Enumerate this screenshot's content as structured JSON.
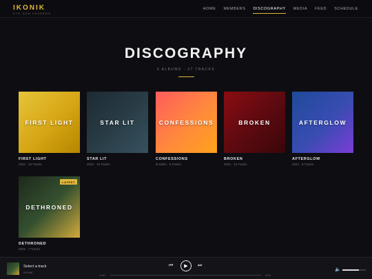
{
  "brand": {
    "logo": "IKONIK",
    "tagline": "5TH GEN LEADERS"
  },
  "nav": [
    {
      "label": "HOME",
      "active": false
    },
    {
      "label": "MEMBERS",
      "active": false
    },
    {
      "label": "DISCOGRAPHY",
      "active": true
    },
    {
      "label": "MEDIA",
      "active": false
    },
    {
      "label": "FEED",
      "active": false
    },
    {
      "label": "SCHEDULE",
      "active": false
    }
  ],
  "hero": {
    "title": "DISCOGRAPHY",
    "subtitle": "6 ALBUMS · 37 TRACKS"
  },
  "albums": [
    {
      "cover_text": "FIRST LIGHT",
      "title": "FIRST LIGHT",
      "meta": "2022 · 10 Tracks",
      "badge": ""
    },
    {
      "cover_text": "STAR LIT",
      "title": "STAR LIT",
      "meta": "2023 · 10 Tracks",
      "badge": ""
    },
    {
      "cover_text": "CONFESSIONS",
      "title": "CONFESSIONS",
      "meta": "B-Sides · 6 Tracks",
      "badge": ""
    },
    {
      "cover_text": "BROKEN",
      "title": "BROKEN",
      "meta": "2024 · 10 Tracks",
      "badge": ""
    },
    {
      "cover_text": "AFTERGLOW",
      "title": "AFTERGLOW",
      "meta": "2024 · 8 Tracks",
      "badge": ""
    },
    {
      "cover_text": "DETHRONED",
      "title": "DETHRONED",
      "meta": "2025 · 7 Tracks",
      "badge": "LATEST"
    }
  ],
  "player": {
    "track_title": "Select a track",
    "artist": "IKONIK",
    "time_current": "0:00",
    "time_total": "0:00",
    "prev_icon": "skip-previous-icon",
    "play_icon": "play-icon",
    "next_icon": "skip-next-icon",
    "volume_icon": "speaker-icon",
    "volume_level": 0.7
  },
  "colors": {
    "accent": "#e2b73a",
    "background": "#0e0e12"
  }
}
